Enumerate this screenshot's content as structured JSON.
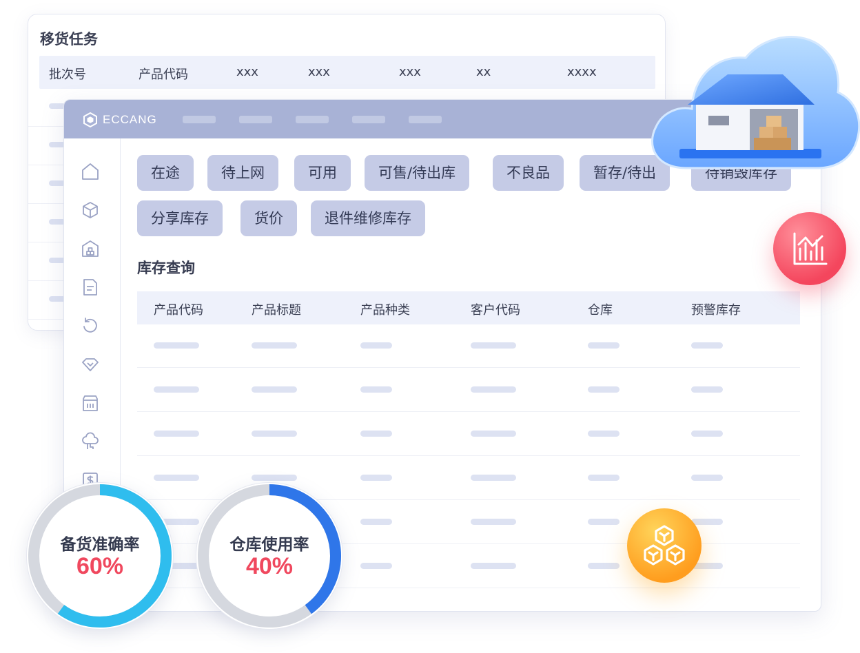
{
  "move_task": {
    "title": "移货任务",
    "columns": [
      "批次号",
      "产品代码",
      "xxx",
      "xxx",
      "xxx",
      "xx",
      "xxxx"
    ]
  },
  "app": {
    "logo_text": "ECCANG"
  },
  "tags": [
    "在途",
    "待上网",
    "可用",
    "可售/待出库",
    "不良品",
    "暂存/待出",
    "待销毁库存",
    "分享库存",
    "货价",
    "退件维修库存"
  ],
  "inventory": {
    "title": "库存查询",
    "columns": [
      "产品代码",
      "产品标题",
      "产品种类",
      "客户代码",
      "仓库",
      "预警库存"
    ]
  },
  "sidebar_icons": [
    "home-icon",
    "package-icon",
    "warehouse-icon",
    "document-icon",
    "refresh-icon",
    "diamond-icon",
    "store-icon",
    "cloud-network-icon",
    "dollar-icon"
  ],
  "gauges": [
    {
      "label": "备货准确率",
      "value_text": "60%",
      "value": 0.6,
      "color": "#2fbdee"
    },
    {
      "label": "仓库使用率",
      "value_text": "40%",
      "value": 0.4,
      "color": "#2f76e9"
    }
  ],
  "colors": {
    "titlebar": "#a8b2d6",
    "tag_bg": "#c5cbe6",
    "accent_red": "#f0485e",
    "badge_orange": "#ff9d1e",
    "badge_red": "#f4465d"
  }
}
